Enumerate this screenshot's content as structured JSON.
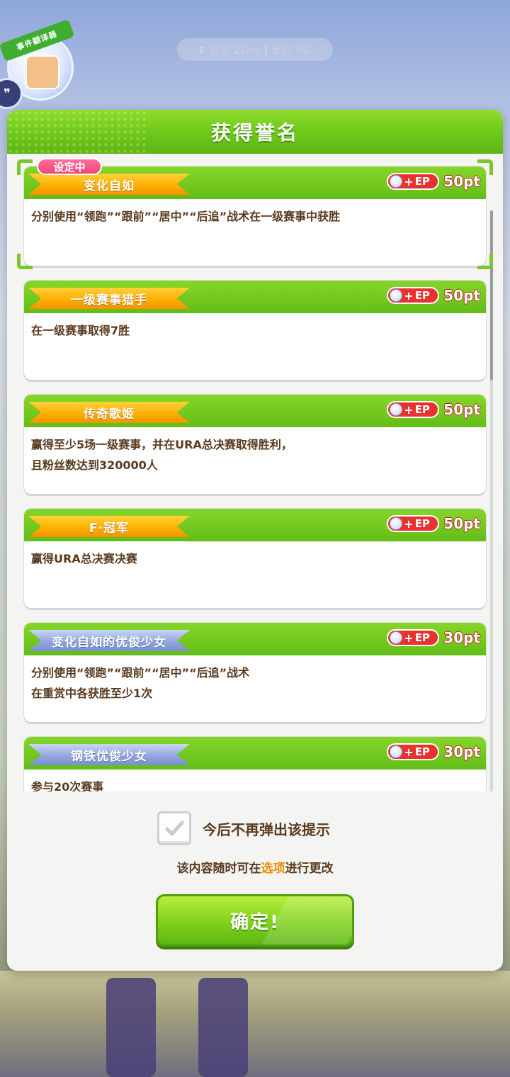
{
  "status_bar": {
    "latency": "延迟: 25ms",
    "packet_loss": "丢包: 0%"
  },
  "event_badge": {
    "label": "事件翻译器"
  },
  "dialog": {
    "title": "获得誉名",
    "setting_badge": "设定中",
    "ep_label": "EP",
    "cards": [
      {
        "title": "变化自如",
        "banner": "gold",
        "points": "50pt",
        "desc": "分别使用“领跑”“跟前”“居中”“后追”战术在一级赛事中获胜"
      },
      {
        "title": "一级赛事猎手",
        "banner": "gold",
        "points": "50pt",
        "desc": "在一级赛事取得7胜"
      },
      {
        "title": "传奇歌姬",
        "banner": "gold",
        "points": "50pt",
        "desc": "赢得至少5场一级赛事，并在URA总决赛取得胜利，\n且粉丝数达到320000人"
      },
      {
        "title": "F·冠军",
        "banner": "gold",
        "points": "50pt",
        "desc": "赢得URA总决赛决赛"
      },
      {
        "title": "变化自如的优俊少女",
        "banner": "silver",
        "points": "30pt",
        "desc": "分别使用“领跑”“跟前”“居中”“后追”战术\n在重赏中各获胜至少1次"
      },
      {
        "title": "钢铁优俊少女",
        "banner": "silver",
        "points": "30pt",
        "desc": "参与20次赛事"
      }
    ],
    "footer": {
      "checkbox_label": "今后不再弹出该提示",
      "checked": true,
      "hint_prefix": "该内容随时可在",
      "hint_link": "选项",
      "hint_suffix": "进行更改",
      "confirm": "确定!"
    }
  },
  "colors": {
    "header_green": "#6bc51a",
    "text_brown": "#5a3a1f",
    "ep_red": "#e8322e",
    "link_orange": "#f08a00",
    "setting_pink": "#f0437a"
  }
}
